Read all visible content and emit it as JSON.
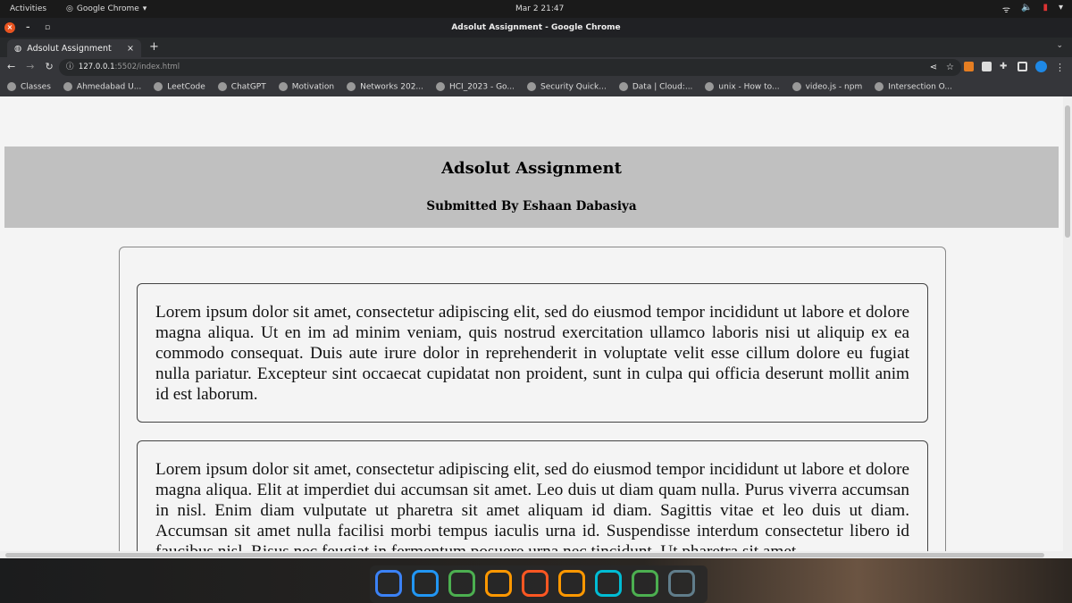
{
  "system": {
    "activities": "Activities",
    "app": "Google Chrome",
    "clock": "Mar 2  21:47"
  },
  "window": {
    "title": "Adsolut Assignment - Google Chrome"
  },
  "tab": {
    "title": "Adsolut Assignment"
  },
  "address": {
    "host": "127.0.0.1",
    "path": ":5502/index.html"
  },
  "bookmarks": [
    "Classes",
    "Ahmedabad U...",
    "LeetCode",
    "ChatGPT",
    "Motivation",
    "Networks 202...",
    "HCI_2023 - Go...",
    "Security Quick...",
    "Data | Cloud:...",
    "unix - How to...",
    "video.js - npm",
    "Intersection O..."
  ],
  "page": {
    "title": "Adsolut Assignment",
    "subtitle": "Submitted By Eshaan Dabasiya",
    "para1": "Lorem ipsum dolor sit amet, consectetur adipiscing elit, sed do eiusmod tempor incididunt ut labore et dolore magna aliqua. Ut en im ad minim veniam, quis nostrud exercitation ullamco laboris nisi ut aliquip ex ea commodo consequat. Duis aute irure dolor in reprehenderit in voluptate velit esse cillum dolore eu fugiat nulla pariatur. Excepteur sint occaecat cupidatat non proident, sunt in culpa qui officia deserunt mollit anim id est laborum.",
    "para2": "Lorem ipsum dolor sit amet, consectetur adipiscing elit, sed do eiusmod tempor incididunt ut labore et dolore magna aliqua. Elit at imperdiet dui accumsan sit amet. Leo duis ut diam quam nulla. Purus viverra accumsan in nisl. Enim diam vulputate ut pharetra sit amet aliquam id diam. Sagittis vitae et leo duis ut diam. Accumsan sit amet nulla facilisi morbi tempus iaculis urna id. Suspendisse interdum consectetur libero id faucibus nisl. Risus nec feugiat in fermentum posuere urna nec tincidunt. Ut pharetra sit amet"
  },
  "dock": [
    {
      "name": "vscode",
      "color": "#3b82f6"
    },
    {
      "name": "text-editor",
      "color": "#2196f3"
    },
    {
      "name": "chrome",
      "color": "#4caf50"
    },
    {
      "name": "brave",
      "color": "#ff9800"
    },
    {
      "name": "files",
      "color": "#ff5722"
    },
    {
      "name": "settings",
      "color": "#ff9800"
    },
    {
      "name": "terminal",
      "color": "#00bcd4"
    },
    {
      "name": "spreadsheet",
      "color": "#4caf50"
    },
    {
      "name": "avatar-app",
      "color": "#607d8b"
    }
  ]
}
